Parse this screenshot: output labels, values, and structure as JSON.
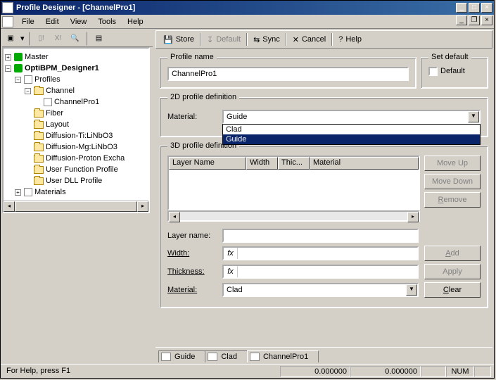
{
  "window": {
    "title": "Profile Designer - [ChannelPro1]",
    "doc_icons": [
      "min",
      "restore",
      "close"
    ]
  },
  "menu": {
    "items": [
      "File",
      "Edit",
      "View",
      "Tools",
      "Help"
    ]
  },
  "tree": {
    "root1": "Master",
    "root2": "OptiBPM_Designer1",
    "profiles": "Profiles",
    "channel": "Channel",
    "channelpro1": "ChannelPro1",
    "others": [
      "Fiber",
      "Layout",
      "Diffusion-Ti:LiNbO3",
      "Diffusion-Mg:LiNbO3",
      "Diffusion-Proton Excha",
      "User Function Profile",
      "User DLL Profile"
    ],
    "materials": "Materials"
  },
  "rtoolbar": {
    "store": "Store",
    "default": "Default",
    "sync": "Sync",
    "cancel": "Cancel",
    "help": "Help"
  },
  "form": {
    "profname_legend": "Profile name",
    "profname_value": "ChannelPro1",
    "setdef_legend": "Set default",
    "setdef_label": "Default",
    "p2d_legend": "2D profile definition",
    "material_label": "Material:",
    "material_value": "Guide",
    "material_options": [
      "Clad",
      "Guide"
    ],
    "p3d_legend": "3D profile definition",
    "lv_cols": [
      "Layer Name",
      "Width",
      "Thic...",
      "Material"
    ],
    "moveup": "Move Up",
    "movedown": "Move Down",
    "remove": "Remove",
    "layername_label": "Layer name:",
    "width_label": "Width:",
    "thickness_label": "Thickness:",
    "material2_label": "Material:",
    "material2_value": "Clad",
    "fx": "fx",
    "add": "Add",
    "apply": "Apply",
    "clear": "Clear"
  },
  "tabs": {
    "items": [
      "Guide",
      "Clad",
      "ChannelPro1"
    ]
  },
  "status": {
    "help": "For Help, press F1",
    "n1": "0.000000",
    "n2": "0.000000",
    "num": "NUM"
  }
}
